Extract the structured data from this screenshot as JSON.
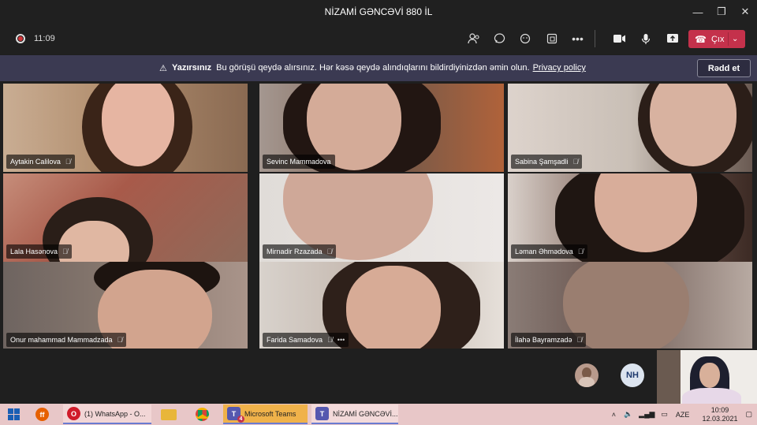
{
  "window": {
    "title": "NİZAMİ GƏNCƏVİ 880 İL",
    "controls": [
      "minimize",
      "maximize",
      "close"
    ]
  },
  "toolbar": {
    "timer": "11:09",
    "leave_label": "Çıx"
  },
  "banner": {
    "title": "Yazırsınız",
    "message": "Bu görüşü qeydə alırsınız. Hər kəsə qeydə alındıqlarını bildirdiyinizdən əmin olun.",
    "link": "Privacy policy",
    "dismiss": "Rədd et"
  },
  "participants": [
    {
      "name": "Aytakin Calilova"
    },
    {
      "name": "Sevinc Mammadova"
    },
    {
      "name": "Sabina Şamşadli"
    },
    {
      "name": "Lala Hasənova"
    },
    {
      "name": "Mirnadir Rzazada"
    },
    {
      "name": "Ləman Əhmədova"
    },
    {
      "name": "Onur mahammad Mammadzada"
    },
    {
      "name": "Farida Samadova"
    },
    {
      "name": "İlahə Bayramzadə"
    }
  ],
  "bottom": {
    "avatar_initials": "NH"
  },
  "taskbar": {
    "apps": [
      {
        "label": "(1) WhatsApp - O..."
      },
      {
        "label": "Microsoft Teams"
      },
      {
        "label": "NİZAMİ GƏNCƏVİ..."
      }
    ],
    "teams_badge": "4",
    "language": "AZE",
    "time": "10:09",
    "date": "12.03.2021"
  }
}
